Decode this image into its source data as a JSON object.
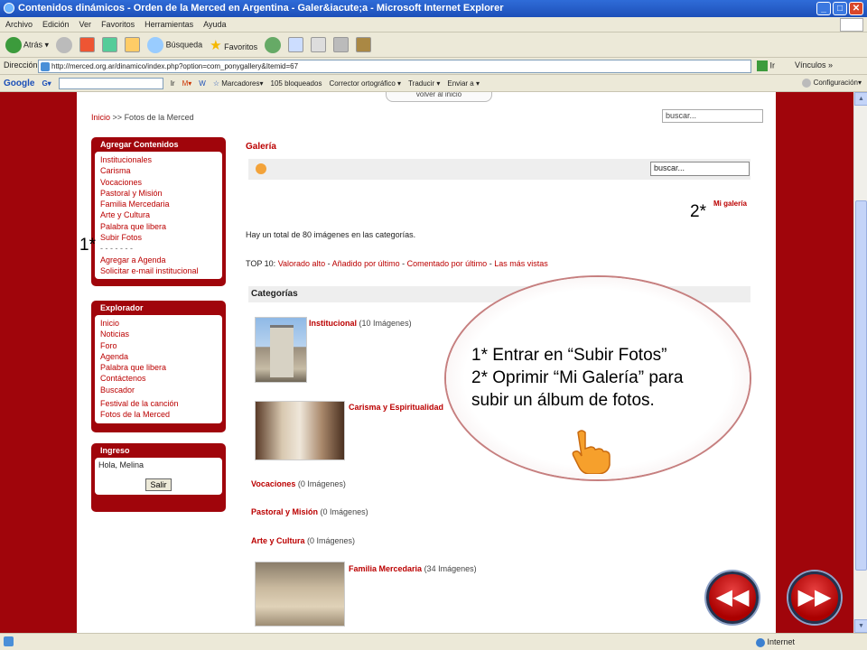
{
  "window": {
    "title": "Contenidos dinámicos - Orden de la Merced en Argentina - Galer&iacute;a - Microsoft Internet Explorer"
  },
  "menu": [
    "Archivo",
    "Edición",
    "Ver",
    "Favoritos",
    "Herramientas",
    "Ayuda"
  ],
  "toolbar": {
    "back": "Atrás",
    "search": "Búsqueda",
    "favorites": "Favoritos"
  },
  "address": {
    "label": "Dirección",
    "url": "http://merced.org.ar/dinamico/index.php?option=com_ponygallery&Itemid=67",
    "go": "Ir",
    "links": "Vínculos"
  },
  "google": {
    "brand": "Google",
    "go": "Ir",
    "bookmarks": "Marcadores",
    "blocked": "105 bloqueados",
    "spell": "Corrector ortográfico",
    "translate": "Traducir",
    "send": "Enviar a",
    "settings": "Configuración"
  },
  "page": {
    "volver": "volver al inicio",
    "breadcrumb": {
      "home": "Inicio",
      "sep": ">>",
      "current": "Fotos de la Merced"
    },
    "search_placeholder": "buscar...",
    "agregar": {
      "title": "Agregar Contenidos",
      "items": [
        "Institucionales",
        "Carisma",
        "Vocaciones",
        "Pastoral y Misión",
        "Familia Mercedaria",
        "Arte y Cultura",
        "Palabra que libera",
        "Subir Fotos",
        "- - - - - - -",
        "Agregar a Agenda",
        "Solicitar e-mail institucional"
      ]
    },
    "explorador": {
      "title": "Explorador",
      "items": [
        "Inicio",
        "Noticias",
        "Foro",
        "Agenda",
        "Palabra que libera",
        "Contáctenos",
        "Buscador"
      ],
      "items2": [
        "Festival de la canción",
        "Fotos de la Merced"
      ]
    },
    "ingreso": {
      "title": "Ingreso",
      "greeting": "Hola, Melina",
      "logout": "Salir"
    },
    "galeria": "Galería",
    "gallery_search": "buscar...",
    "mi_galeria": "Mi galería",
    "total": "Hay un total de 80 imágenes en las categorías.",
    "top10": {
      "label": "TOP 10:",
      "links": [
        "Valorado alto",
        "Añadido por último",
        "Comentado por último",
        "Las más vistas"
      ],
      "sep": " - "
    },
    "categorias_header": "Categorías",
    "categories": [
      {
        "name": "Institucional",
        "count": "(10 Imágenes)"
      },
      {
        "name": "Carisma y Espiritualidad",
        "count": ""
      },
      {
        "name": "Vocaciones",
        "count": "(0 Imágenes)"
      },
      {
        "name": "Pastoral y Misión",
        "count": "(0 Imágenes)"
      },
      {
        "name": "Arte y Cultura",
        "count": "(0 Imágenes)"
      },
      {
        "name": "Familia Mercedaria",
        "count": "(34 Imágenes)"
      }
    ]
  },
  "annotations": {
    "mark1": "1*",
    "mark2": "2*",
    "line1": "1* Entrar en “Subir Fotos”",
    "line2": "2* Oprimir “Mi Galería” para",
    "line3": "subir un álbum de fotos."
  },
  "status": {
    "zone": "Internet"
  },
  "colors": {
    "brand_red": "#a0050b",
    "link_red": "#bb0000"
  }
}
